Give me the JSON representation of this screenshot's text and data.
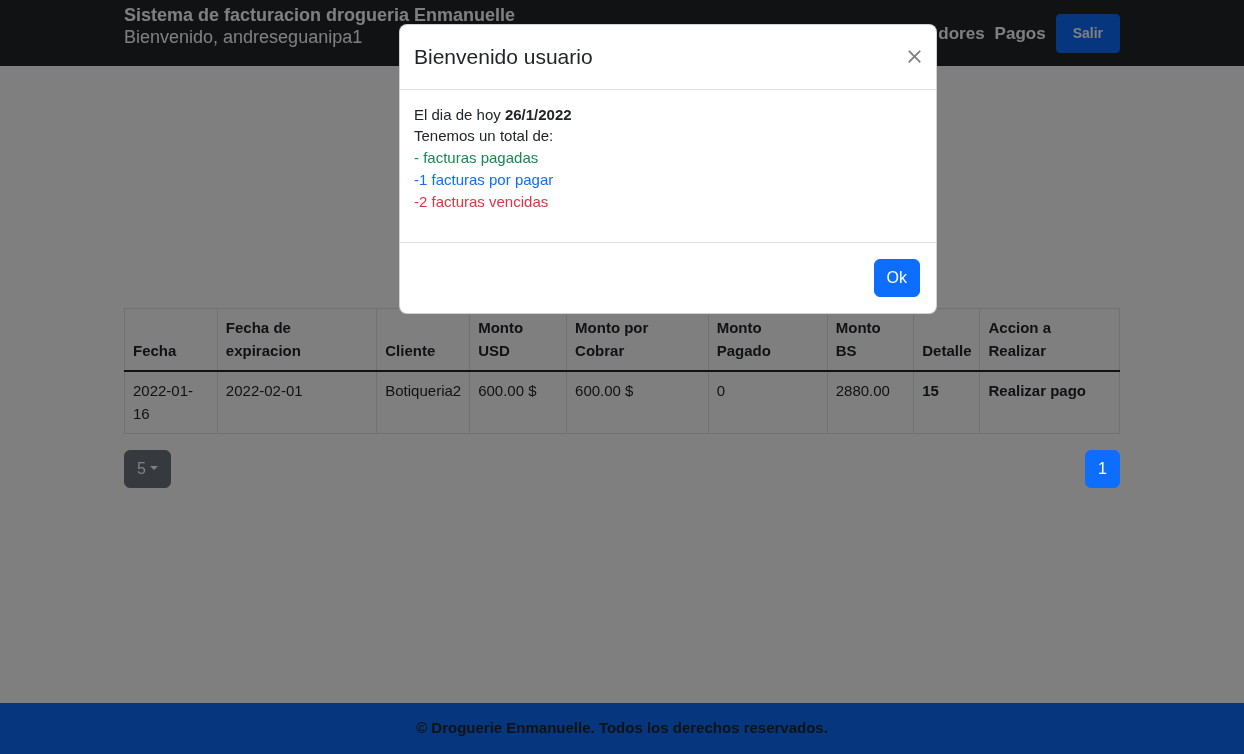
{
  "navbar": {
    "title": "Sistema de facturacion drogueria Enmanuelle",
    "welcome": "Bienvenido, andreseguanipa1",
    "links": [
      {
        "label": "dores"
      },
      {
        "label": "Pagos"
      }
    ],
    "logout_button": "Salir"
  },
  "table": {
    "columns": [
      "Fecha",
      "Fecha de expiracion",
      "Cliente",
      "Monto USD",
      "Monto por Cobrar",
      "Monto Pagado",
      "Monto BS",
      "Detalle",
      "Accion a Realizar"
    ],
    "rows": [
      {
        "cells": [
          {
            "text": "2022-01-16",
            "kind": "text"
          },
          {
            "text": "2022-02-01",
            "kind": "text"
          },
          {
            "text": "Botiqueria2",
            "kind": "text"
          },
          {
            "text": "600.00 $",
            "kind": "text"
          },
          {
            "text": "600.00 $",
            "kind": "text"
          },
          {
            "text": "0",
            "kind": "text"
          },
          {
            "text": "2880.00",
            "kind": "text"
          },
          {
            "text": "15",
            "kind": "link"
          },
          {
            "text": "Realizar pago",
            "kind": "link"
          }
        ]
      }
    ]
  },
  "page_size": "5",
  "pagination": [
    {
      "label": "1",
      "selected": true
    }
  ],
  "footer": "© Droguerie Enmanuelle. Todos los derechos reservados.",
  "modal": {
    "title": "Bienvenido usuario",
    "lines": [
      {
        "text": "El dia de hoy **26/1/2022**",
        "color": "#212529"
      },
      {
        "text": "Tenemos un total de:",
        "color": "#212529"
      },
      {
        "text": "- facturas pagadas",
        "color": "#198754"
      },
      {
        "text": "-1 facturas por pagar",
        "color": "#0d6efd"
      },
      {
        "text": "-2 facturas vencidas",
        "color": "#dc3545"
      }
    ],
    "ok_button": "Ok"
  }
}
